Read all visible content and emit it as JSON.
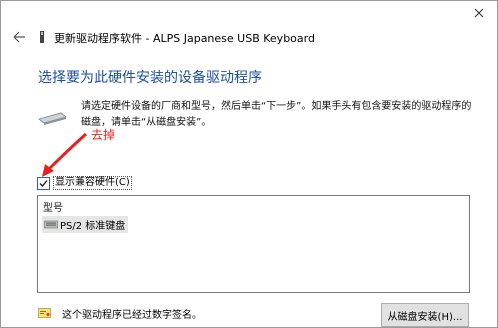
{
  "window": {
    "title": "更新驱动程序软件 - ALPS Japanese USB Keyboard",
    "close_glyph": "✕",
    "back_glyph": "←"
  },
  "main": {
    "heading": "选择要为此硬件安装的设备驱动程序",
    "instruction": "请选定硬件设备的厂商和型号，然后单击“下一步”。如果手头有包含要安装的驱动程序的磁盘，请单击“从磁盘安装”。",
    "annotation": "去掉",
    "show_compatible_label": "显示兼容硬件(C)",
    "show_compatible_checked": true,
    "model_list": {
      "column_header": "型号",
      "items": [
        "PS/2 标准键盘"
      ]
    },
    "signed_text": "这个驱动程序已经过数字签名。",
    "have_disk_button": "从磁盘安装(H)..."
  },
  "colors": {
    "heading": "#1d4fa3",
    "annotation": "#e8211f",
    "accent": "#2c63a8"
  }
}
